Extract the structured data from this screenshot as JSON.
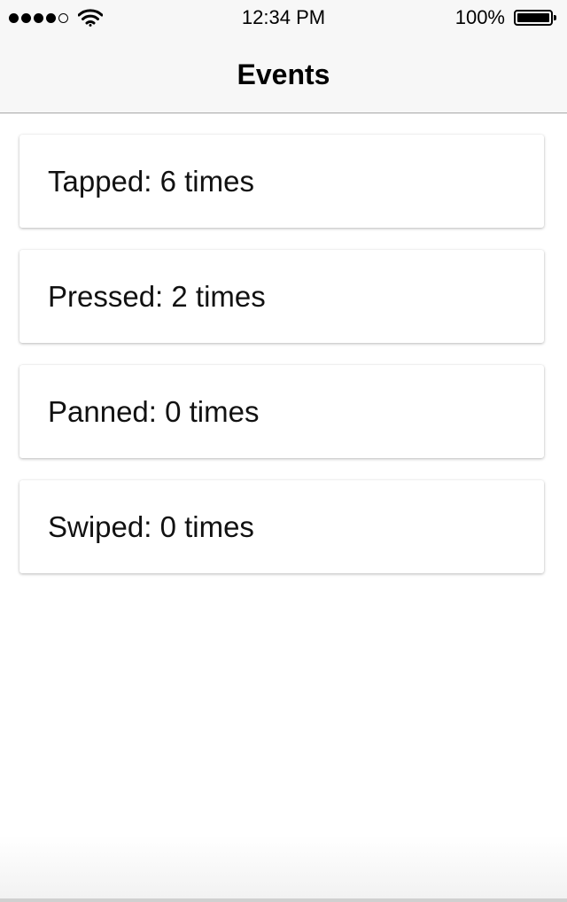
{
  "status_bar": {
    "signal_icon": "cellular-signal-icon",
    "wifi_icon": "wifi-icon",
    "time": "12:34 PM",
    "battery_percent": "100%",
    "battery_icon": "battery-icon"
  },
  "nav_bar": {
    "title": "Events"
  },
  "events": [
    {
      "label": "Tapped: 6 times"
    },
    {
      "label": "Pressed: 2 times"
    },
    {
      "label": "Panned: 0 times"
    },
    {
      "label": "Swiped: 0 times"
    }
  ],
  "colors": {
    "bar_background": "#f7f7f7",
    "divider": "#a8a8a8",
    "card_background": "#ffffff"
  }
}
